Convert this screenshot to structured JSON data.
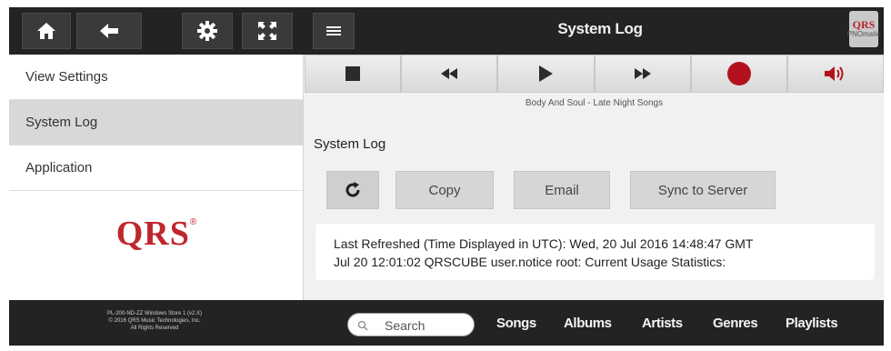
{
  "header": {
    "title": "System Log",
    "buttons": [
      {
        "icon": "home-icon"
      },
      {
        "icon": "back-arrow-icon"
      },
      {
        "icon": "gear-icon"
      },
      {
        "icon": "fullscreen-icon"
      },
      {
        "icon": "menu-icon"
      }
    ],
    "logo": {
      "line1": "QRS",
      "line2": "PNOmatic"
    }
  },
  "sidebar": {
    "items": [
      {
        "label": "View Settings"
      },
      {
        "label": "System Log",
        "active": true
      },
      {
        "label": "Application"
      }
    ],
    "logo": "QRS",
    "logo_mark": "®"
  },
  "transport": {
    "buttons": [
      "stop-icon",
      "rewind-icon",
      "play-icon",
      "fast-forward-icon",
      "record-icon",
      "volume-icon"
    ],
    "track": "Body And Soul - Late Night Songs",
    "record_color": "#b3121d",
    "volume_color": "#b3121d"
  },
  "main": {
    "section_title": "System Log",
    "actions": {
      "copy": "Copy",
      "email": "Email",
      "sync": "Sync to Server"
    },
    "log_lines": [
      "Last Refreshed (Time Displayed in UTC): Wed, 20 Jul 2016 14:48:47 GMT",
      "Jul 20 12:01:02 QRSCUBE user.notice root: Current Usage Statistics:"
    ]
  },
  "footer": {
    "copyright_lines": [
      "PL-200-ND-ZZ Windows Store 1 (v2.X)",
      "© 2016 QRS Music Technologies, Inc.",
      "All Rights Reserved"
    ],
    "search_placeholder": "Search",
    "nav": [
      "Songs",
      "Albums",
      "Artists",
      "Genres",
      "Playlists"
    ]
  },
  "colors": {
    "bar_dark": "#232323",
    "brand_red": "#c0262d",
    "panel": "#f1f1f1"
  }
}
